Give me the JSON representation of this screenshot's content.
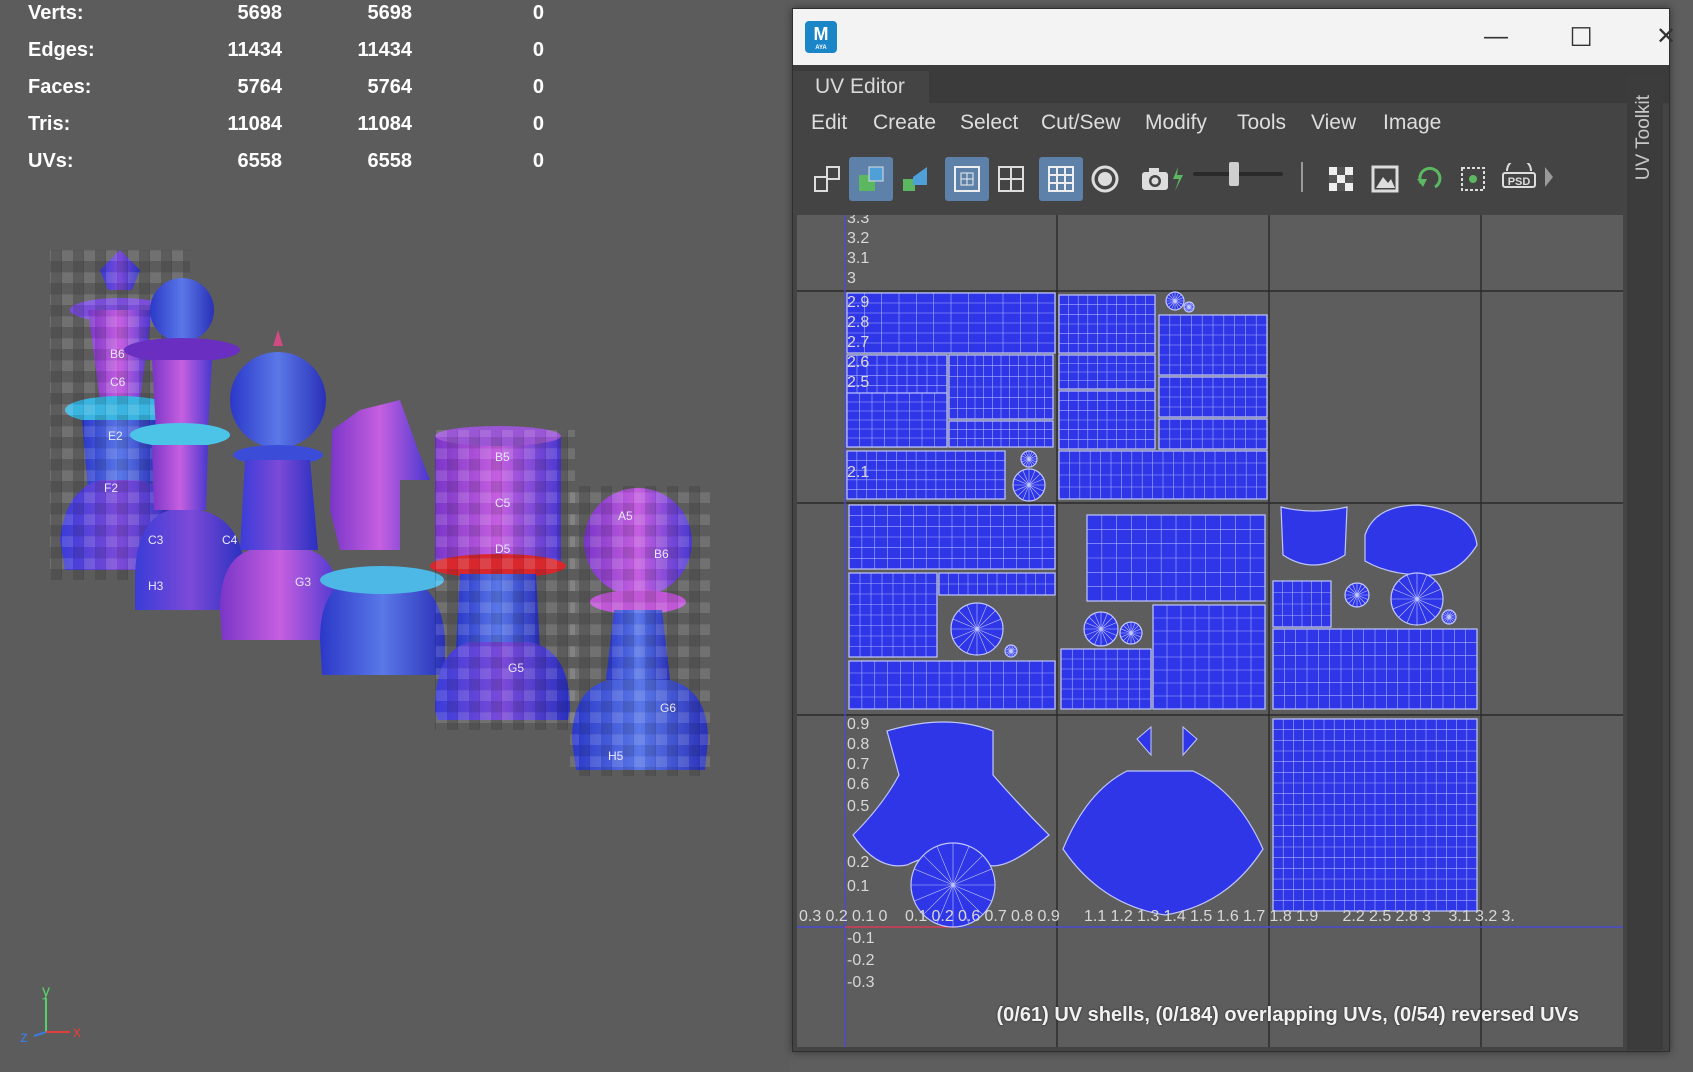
{
  "hud": {
    "rows": [
      {
        "label": "Verts:",
        "c1": "5698",
        "c2": "5698",
        "c3": "0"
      },
      {
        "label": "Edges:",
        "c1": "11434",
        "c2": "11434",
        "c3": "0"
      },
      {
        "label": "Faces:",
        "c1": "5764",
        "c2": "5764",
        "c3": "0"
      },
      {
        "label": "Tris:",
        "c1": "11084",
        "c2": "11084",
        "c3": "0"
      },
      {
        "label": "UVs:",
        "c1": "6558",
        "c2": "6558",
        "c3": "0"
      }
    ]
  },
  "chess": {
    "labels": [
      "B6",
      "C6",
      "E2",
      "F2",
      "G3",
      "C3",
      "C4",
      "H3",
      "B5",
      "C5",
      "D5",
      "G5",
      "A5",
      "B6",
      "G6",
      "H5"
    ]
  },
  "axis": {
    "x": "x",
    "y": "y",
    "z": "z"
  },
  "window": {
    "app_icon_letter": "M",
    "app_icon_sub": "AYA",
    "minimize": "—",
    "maximize": "☐",
    "close": "✕",
    "tab_label": "UV Editor",
    "menus": [
      "Edit",
      "Create",
      "Select",
      "Cut/Sew",
      "Modify",
      "Tools",
      "View",
      "Image"
    ],
    "side_panel_label": "UV Toolkit",
    "toolbar_icons": [
      "uv-shell-icon",
      "uv-layout-icon",
      "shaded-icon",
      "grid-toggle-icon",
      "grid-icon",
      "checker-grid-icon",
      "isolate-icon",
      "snapshot-icon",
      "exposure-icon",
      "checker-icon",
      "image-icon",
      "rotate-icon",
      "pixel-snap-icon",
      "psd-icon"
    ],
    "psd_text": "PSD",
    "status": "(0/61) UV shells, (0/184) overlapping UVs, (0/54) reversed UVs"
  },
  "uv_axis": {
    "y_labels_top": [
      "3.3",
      "3.2",
      "3.1",
      "3",
      "2.9",
      "2.8",
      "2.7",
      "2.6",
      "2.5",
      "2.1"
    ],
    "y_labels_bottom": [
      "0.9",
      "0.8",
      "0.7",
      "0.6",
      "0.5",
      "0.2",
      "0.1",
      "-0.1",
      "-0.2",
      "-0.3"
    ],
    "x_labels": [
      "0.3",
      "0.2",
      "0.1",
      "0",
      "0.1",
      "0.2",
      "0.6",
      "0.7",
      "0.8",
      "0.9",
      "1.1",
      "1.2",
      "1.3",
      "1.4",
      "1.5",
      "1.6",
      "1.7",
      "1.8",
      "1.9",
      "2.2",
      "2.5",
      "2.8",
      "3",
      "3.1",
      "3.2",
      "3."
    ]
  },
  "colors": {
    "uv_fill": "#2e36e8",
    "uv_line": "#c0c6ff",
    "active_btn": "#5d81a8"
  }
}
